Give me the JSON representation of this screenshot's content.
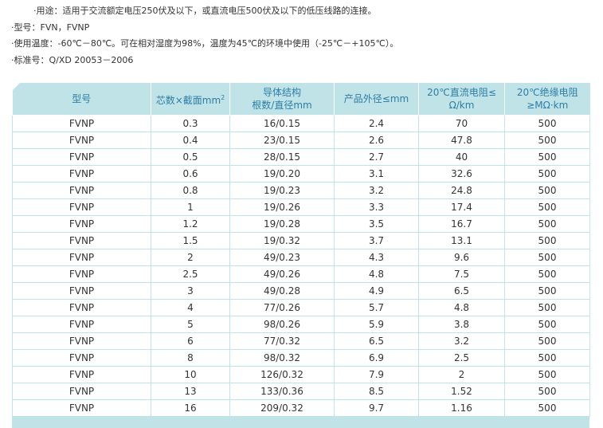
{
  "notes": [
    {
      "text": "·用途：适用于交流额定电压250伏及以下，或直流电压500伏及以下的低压线路的连接。"
    },
    {
      "text": "·型号：FVN，FVNP"
    },
    {
      "text": "·使用温度：-60℃－80℃。可在相对湿度为98%，温度为45℃的环境中使用（-25℃－+105℃）。"
    },
    {
      "text": "·标准号：Q/XD 20053－2006"
    }
  ],
  "table": {
    "headers": [
      {
        "line1": "型号",
        "line2": ""
      },
      {
        "line1": "芯数×截面mm",
        "sup": "2",
        "line2": ""
      },
      {
        "line1": "导体结构",
        "line2": "根数/直径mm"
      },
      {
        "line1": "产品外径≤mm",
        "line2": ""
      },
      {
        "line1": "20℃直流电阻≤",
        "line2": "Ω/km"
      },
      {
        "line1": "20℃绝缘电阻",
        "line2": "≥MΩ·km"
      }
    ],
    "rows": [
      [
        "FVNP",
        "0.3",
        "16/0.15",
        "2.4",
        "70",
        "500"
      ],
      [
        "FVNP",
        "0.4",
        "23/0.15",
        "2.6",
        "47.8",
        "500"
      ],
      [
        "FVNP",
        "0.5",
        "28/0.15",
        "2.7",
        "40",
        "500"
      ],
      [
        "FVNP",
        "0.6",
        "19/0.20",
        "3.1",
        "32.6",
        "500"
      ],
      [
        "FVNP",
        "0.8",
        "19/0.23",
        "3.2",
        "24.8",
        "500"
      ],
      [
        "FVNP",
        "1",
        "19/0.26",
        "3.3",
        "17.4",
        "500"
      ],
      [
        "FVNP",
        "1.2",
        "19/0.28",
        "3.5",
        "16.7",
        "500"
      ],
      [
        "FVNP",
        "1.5",
        "19/0.32",
        "3.7",
        "13.1",
        "500"
      ],
      [
        "FVNP",
        "2",
        "49/0.23",
        "4.3",
        "9.6",
        "500"
      ],
      [
        "FVNP",
        "2.5",
        "49/0.26",
        "4.8",
        "7.5",
        "500"
      ],
      [
        "FVNP",
        "3",
        "49/0.28",
        "4.9",
        "6.5",
        "500"
      ],
      [
        "FVNP",
        "4",
        "77/0.26",
        "5.7",
        "4.8",
        "500"
      ],
      [
        "FVNP",
        "5",
        "98/0.26",
        "5.9",
        "3.8",
        "500"
      ],
      [
        "FVNP",
        "6",
        "77/0.32",
        "6.5",
        "3.2",
        "500"
      ],
      [
        "FVNP",
        "8",
        "98/0.32",
        "6.9",
        "2.5",
        "500"
      ],
      [
        "FVNP",
        "10",
        "126/0.32",
        "7.9",
        "2",
        "500"
      ],
      [
        "FVNP",
        "13",
        "133/0.36",
        "8.5",
        "1.52",
        "500"
      ],
      [
        "FVNP",
        "16",
        "209/0.32",
        "9.7",
        "1.16",
        "500"
      ]
    ]
  },
  "colors": {
    "header_bg": "#bfe3e7",
    "header_text": "#2e7ea6",
    "body_text": "#333333"
  }
}
